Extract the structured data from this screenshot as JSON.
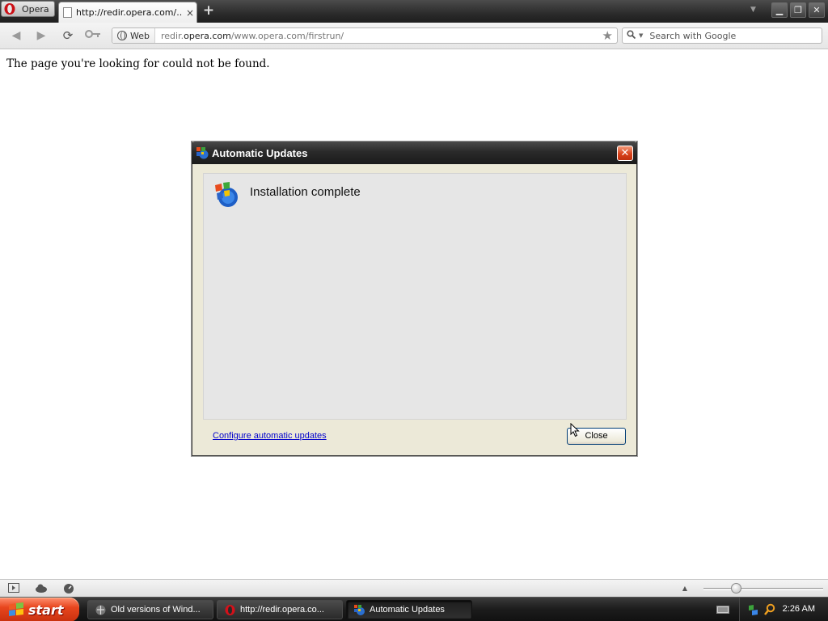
{
  "browser": {
    "menu_label": "Opera",
    "tab_title": "http://redir.opera.com/...",
    "tab_close": "×",
    "new_tab": "+",
    "url_badge": "Web",
    "url_prefix": "redir.",
    "url_domain": "opera.com",
    "url_rest": "/www.opera.com/firstrun/",
    "search_placeholder": "Search with Google"
  },
  "page": {
    "message": "The page you're looking for could not be found."
  },
  "dialog": {
    "title": "Automatic Updates",
    "heading": "Installation complete",
    "link": "Configure automatic updates",
    "close_button": "Close",
    "close_x": "✕"
  },
  "taskbar": {
    "start_label": "start",
    "tasks": [
      {
        "label": "Old versions of Wind..."
      },
      {
        "label": "http://redir.opera.co..."
      },
      {
        "label": "Automatic Updates"
      }
    ],
    "clock": "2:26 AM"
  },
  "colors": {
    "link": "#0000cc",
    "start_button": "#e8461e",
    "dialog_close": "#d8421a"
  }
}
